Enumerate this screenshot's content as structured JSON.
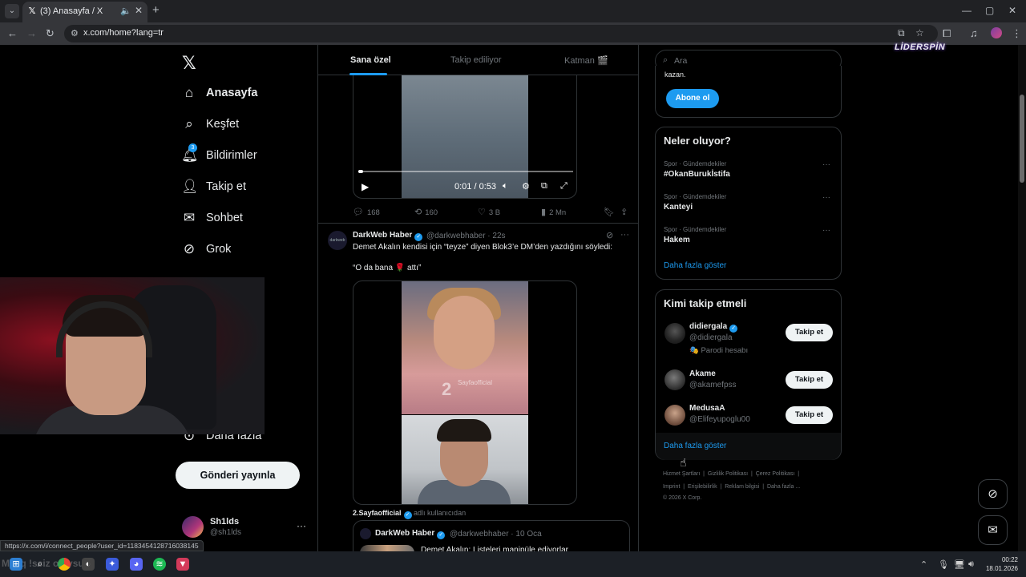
{
  "browser": {
    "tab_title": "(3) Anasayfa / X",
    "url": "x.com/home?lang=tr",
    "status_url": "https://x.com/i/connect_people?user_id=1183454128716038145"
  },
  "nav": {
    "items": [
      {
        "label": "Anasayfa",
        "icon": "home-icon"
      },
      {
        "label": "Keşfet",
        "icon": "search-icon"
      },
      {
        "label": "Bildirimler",
        "icon": "bell-icon",
        "badge": "3"
      },
      {
        "label": "Takip et",
        "icon": "add-person-icon"
      },
      {
        "label": "Sohbet",
        "icon": "mail-icon"
      },
      {
        "label": "Grok",
        "icon": "grok-icon"
      },
      {
        "label": "Daha fazla",
        "icon": "more-circle-icon"
      }
    ],
    "post_button": "Gönderi yayınla",
    "user_name": "Sh1lds",
    "user_handle": "@sh1lds"
  },
  "feed_tabs": [
    "Sana özel",
    "Takip ediliyor",
    "Katman 🎬"
  ],
  "video_post": {
    "time": "0:01 / 0:53",
    "replies": "168",
    "reposts": "160",
    "likes": "3 B",
    "views": "2 Mn"
  },
  "post": {
    "author": "DarkWeb Haber",
    "meta": "@darkwebhaber · 22s",
    "avatar_text": "darkweb",
    "text1": "Demet Akalın kendisi için “teyze” diyen Blok3’e DM’den yazdığını söyledi:",
    "text2": "“O da bana 🌹 attı”",
    "watermark": "Sayfaofficial",
    "byline_user": "2.Sayfaofficial",
    "byline_suffix": " adlı kullanıcıdan",
    "quote_author": "DarkWeb Haber",
    "quote_meta": "@darkwebhaber · 10 Oca",
    "quote_text": "Demet Akalın: Listeleri manipüle ediyorlar"
  },
  "sidebar": {
    "search_placeholder": "Ara",
    "brand": "LİDERSPİN",
    "premium_fragment": "kazan.",
    "subscribe": "Abone ol",
    "trends_title": "Neler oluyor?",
    "trends": [
      {
        "category": "Spor · Gündemdekiler",
        "name": "#OkanBurukİstifa"
      },
      {
        "category": "Spor · Gündemdekiler",
        "name": "Kanteyi"
      },
      {
        "category": "Spor · Gündemdekiler",
        "name": "Hakem"
      }
    ],
    "show_more": "Daha fazla göster",
    "wtf_title": "Kimi takip etmeli",
    "who_to_follow": [
      {
        "name": "didiergala",
        "handle": "@didiergala",
        "extra": "🎭 Parodi hesabı",
        "verified": true
      },
      {
        "name": "Akame",
        "handle": "@akamefpss",
        "extra": "",
        "verified": false
      },
      {
        "name": "MedusaA",
        "handle": "@Elifeyupoglu00",
        "extra": "",
        "verified": false
      }
    ],
    "follow_label": "Takip et",
    "footer_line1": [
      "Hizmet Şartları",
      "Gizlilik Politikası",
      "Çerez Politikası"
    ],
    "footer_line2": [
      "Imprint",
      "Erişilebilirlik",
      "Reklam bilgisi",
      "Daha fazla ..."
    ],
    "copyright": "© 2026 X Corp."
  },
  "taskbar": {
    "ghost_text": "Maxq !sciz oluysun",
    "time": "00:22",
    "date": "18.01.2026"
  },
  "colors": {
    "accent": "#1d9bf0",
    "background": "#000000",
    "border": "#2f3336"
  }
}
